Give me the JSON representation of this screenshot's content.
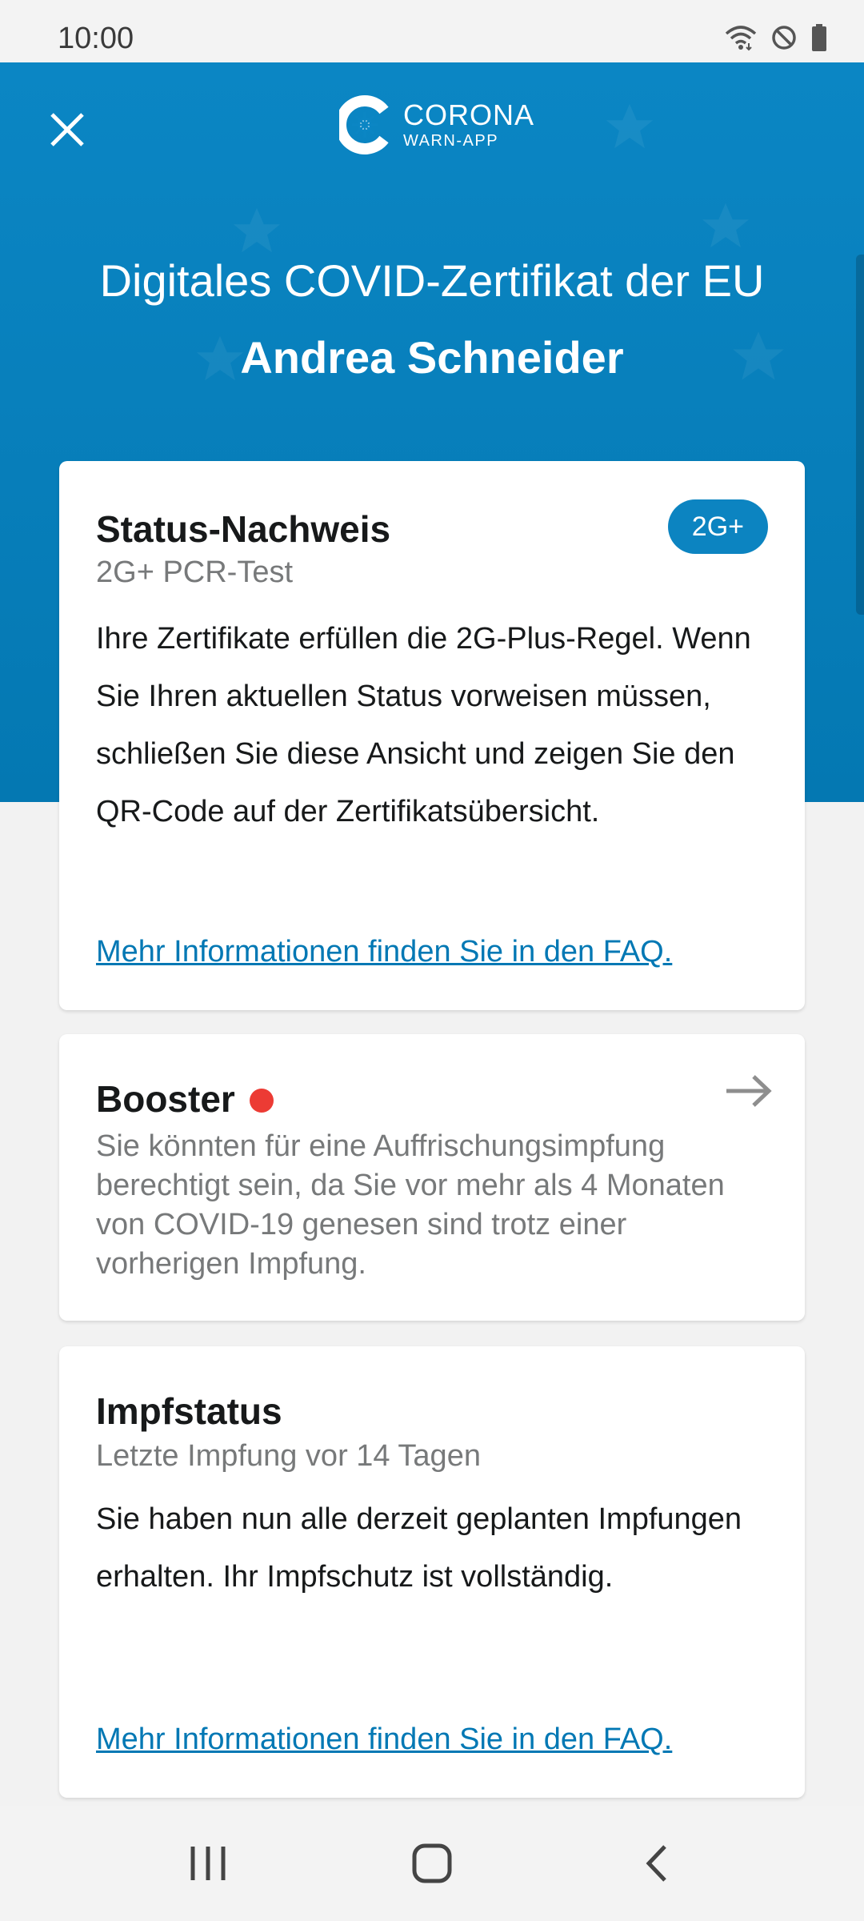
{
  "status_bar": {
    "time": "10:00",
    "icons": [
      "wifi-icon",
      "do-not-disturb-icon",
      "battery-icon"
    ]
  },
  "header": {
    "logo_line1": "CORONA",
    "logo_line2": "WARN-APP",
    "title": "Digitales COVID-Zertifikat der EU",
    "name": "Andrea Schneider",
    "background_color": "#0478b2"
  },
  "status_card": {
    "title": "Status-Nachweis",
    "subtitle": "2G+ PCR-Test",
    "badge": "2G+",
    "body": "Ihre Zertifikate erfüllen die 2G-Plus-Regel. Wenn Sie Ihren aktuellen Status vorweisen müssen, schließen Sie diese Ansicht und zeigen Sie den QR-Code auf der Zertifikatsübersicht.",
    "link": "Mehr Informationen finden Sie in den FAQ."
  },
  "booster_card": {
    "title": "Booster",
    "body": "Sie könnten für eine Auffrischungsimpfung berechtigt sein, da Sie vor mehr als 4 Monaten von COVID-19 genesen sind trotz einer vorherigen Impfung.",
    "indicator_color": "#ec3b34"
  },
  "impf_card": {
    "title": "Impfstatus",
    "subtitle": "Letzte Impfung vor 14 Tagen",
    "body": "Sie haben nun alle derzeit geplanten Impfungen erhalten. Ihr Impfschutz ist vollständig.",
    "link": "Mehr Informationen finden Sie in den FAQ."
  },
  "nav": {
    "buttons": [
      "recent-apps-icon",
      "home-icon",
      "back-icon"
    ]
  }
}
